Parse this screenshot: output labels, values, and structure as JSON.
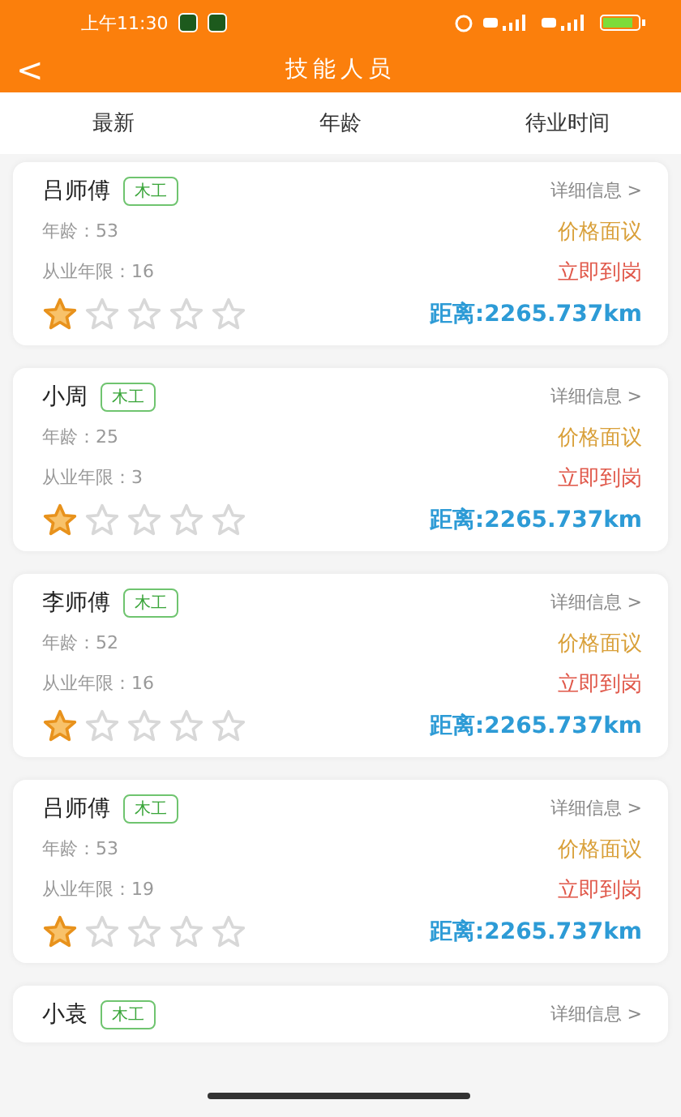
{
  "status_bar": {
    "time": "上午11:30"
  },
  "header": {
    "back": "<",
    "title": "技能人员"
  },
  "tabs": [
    {
      "label": "最新",
      "selected": false
    },
    {
      "label": "年龄",
      "selected": false
    },
    {
      "label": "待业时间",
      "selected": false
    }
  ],
  "workers": [
    {
      "name": "吕师傅",
      "tag": "木工",
      "detail": "详细信息 >",
      "age": "年龄：53",
      "years": "从业年限：16",
      "price": "价格面议",
      "availability": "立即到岗",
      "stars": 1,
      "distance": "距离:2265.737km"
    },
    {
      "name": "小周",
      "tag": "木工",
      "detail": "详细信息 >",
      "age": "年龄：25",
      "years": "从业年限：3",
      "price": "价格面议",
      "availability": "立即到岗",
      "stars": 1,
      "distance": "距离:2265.737km"
    },
    {
      "name": "李师傅",
      "tag": "木工",
      "detail": "详细信息 >",
      "age": "年龄：52",
      "years": "从业年限：16",
      "price": "价格面议",
      "availability": "立即到岗",
      "stars": 1,
      "distance": "距离:2265.737km"
    },
    {
      "name": "吕师傅",
      "tag": "木工",
      "detail": "详细信息 >",
      "age": "年龄：53",
      "years": "从业年限：19",
      "price": "价格面议",
      "availability": "立即到岗",
      "stars": 1,
      "distance": "距离:2265.737km"
    },
    {
      "name": "小袁",
      "tag": "木工",
      "detail": "详细信息 >"
    }
  ]
}
